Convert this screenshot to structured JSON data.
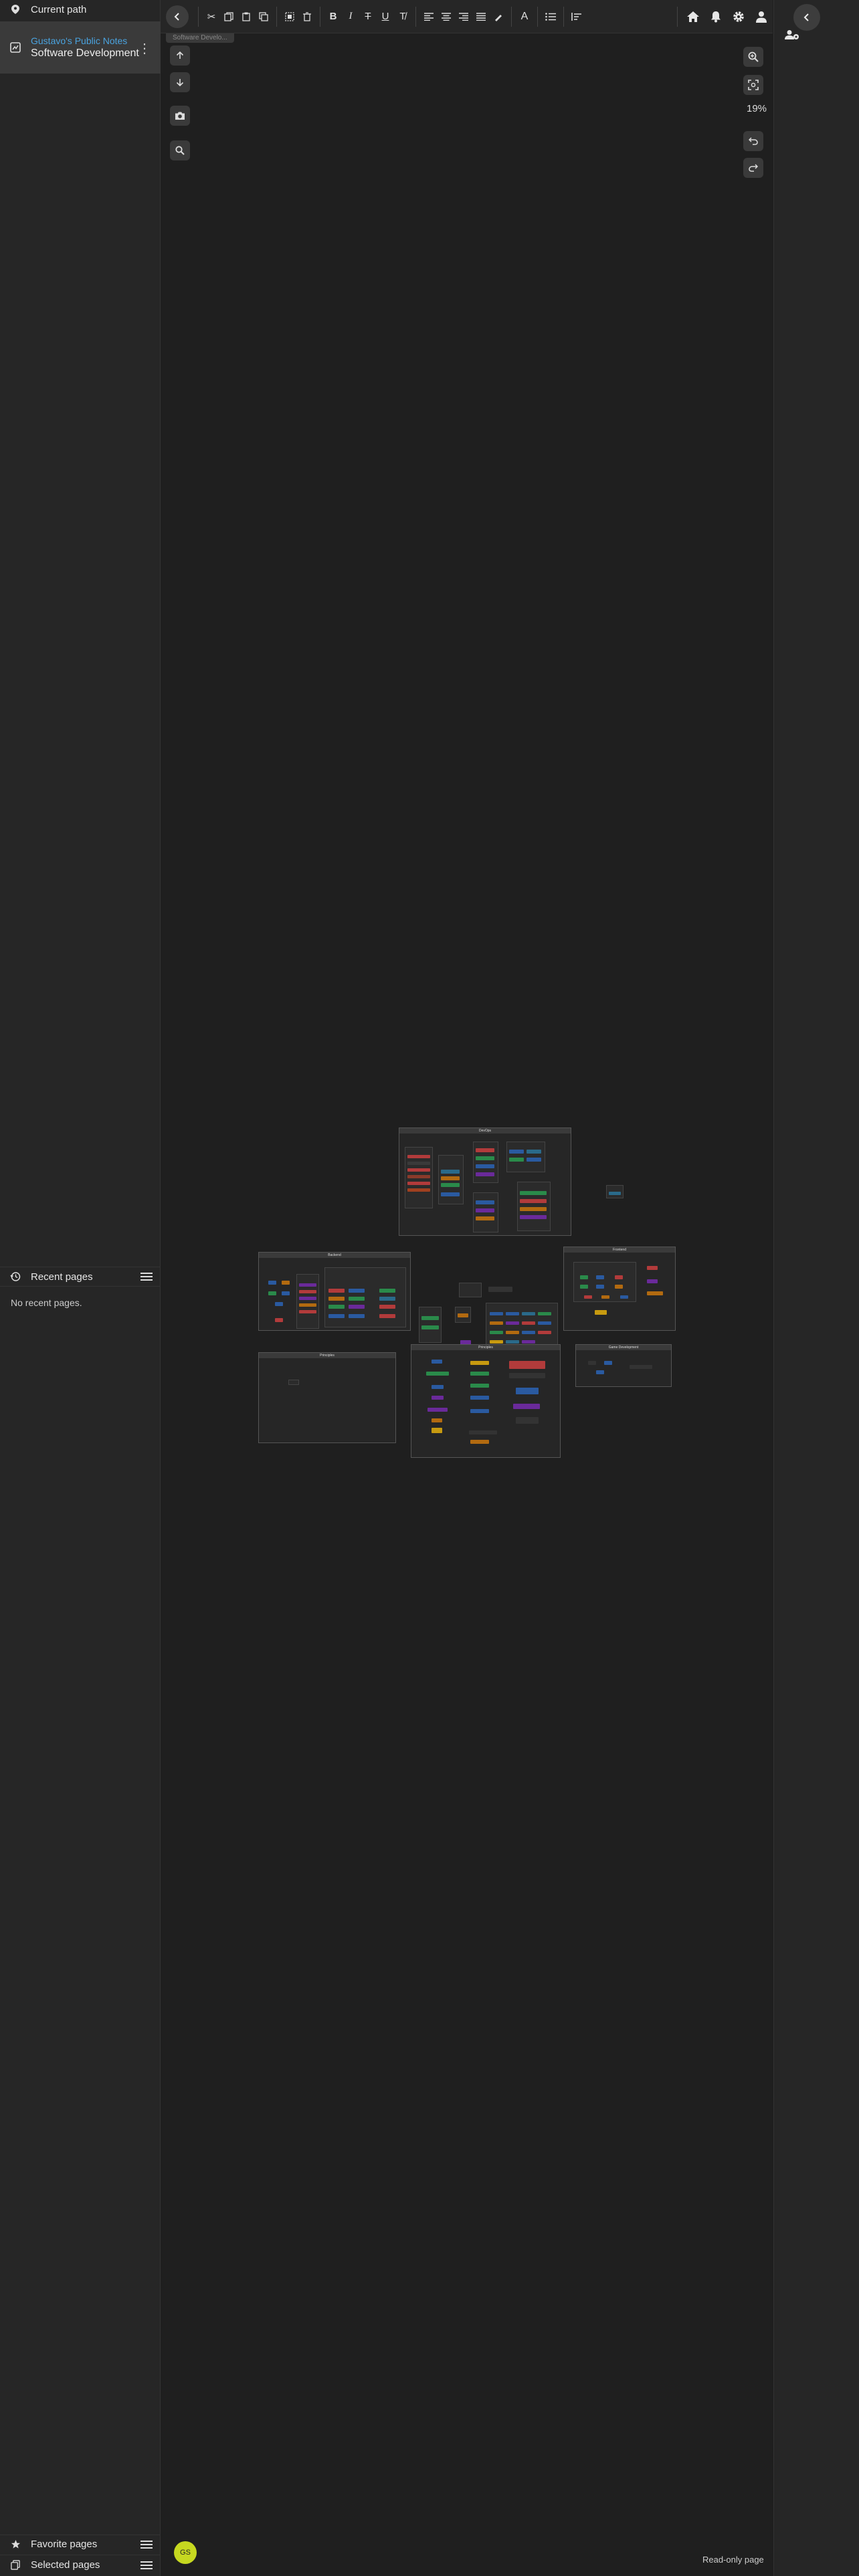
{
  "sidebar": {
    "current_path_label": "Current path",
    "page_parent": "Gustavo's Public Notes",
    "page_title": "Software Development",
    "recent_header": "Recent pages",
    "recent_empty": "No recent pages.",
    "favorites_label": "Favorite pages",
    "selected_label": "Selected pages"
  },
  "toolbar": {
    "icons": [
      "back-icon",
      "cut-icon",
      "copy-icon",
      "paste-icon",
      "duplicate-icon",
      "select-icon",
      "delete-icon",
      "bold-icon",
      "italic-icon",
      "strikethrough-icon",
      "underline-icon",
      "clear-format-icon",
      "align-left-icon",
      "align-center-icon",
      "align-right-icon",
      "align-justify-icon",
      "highlight-icon",
      "text-color-icon",
      "list-icon",
      "align-top-icon"
    ],
    "home": "home-icon",
    "notifications": "bell-icon",
    "settings": "gear-icon",
    "account": "user-icon"
  },
  "canvas": {
    "page_chip": "Software Develo...",
    "zoom_level": "19%",
    "read_only": "Read-only page",
    "avatar_initials": "GS"
  },
  "diagram": {
    "devops": "DevOps",
    "backend": "Backend",
    "frontend": "Frontend",
    "principles": "Principles",
    "databases": "Databases",
    "game_dev": "Game Development",
    "misc": "Misc"
  },
  "colors": {
    "bg": "#1f1f1f",
    "panel": "#262626",
    "accent_link": "#4aa3df",
    "avatar": "#c6d820"
  }
}
